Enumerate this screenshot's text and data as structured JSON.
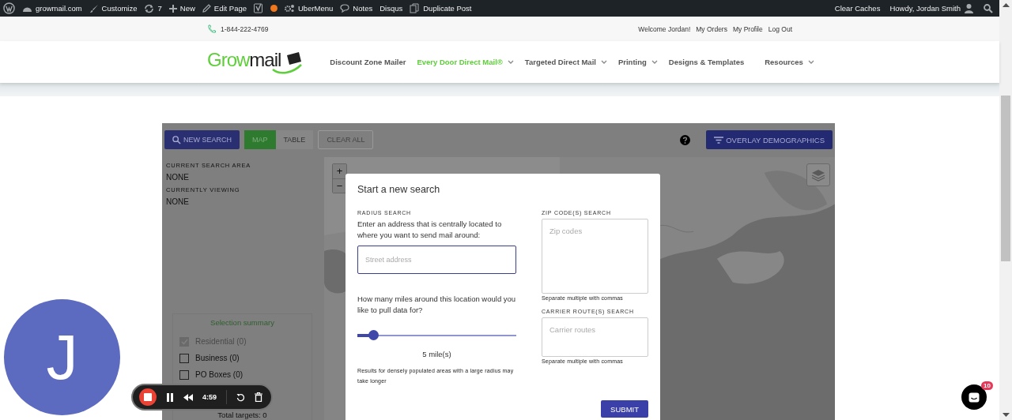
{
  "admin_bar": {
    "items": [
      {
        "kind": "wordpress"
      },
      {
        "kind": "site",
        "label": "growmail.com"
      },
      {
        "kind": "customize",
        "label": "Customize"
      },
      {
        "kind": "updates",
        "label": "7"
      },
      {
        "kind": "new",
        "label": "New"
      },
      {
        "kind": "edit",
        "label": "Edit Page"
      },
      {
        "kind": "seo"
      },
      {
        "kind": "status"
      },
      {
        "kind": "gears",
        "label": "UberMenu"
      },
      {
        "kind": "notes",
        "label": "Notes"
      },
      {
        "kind": "plain",
        "label": "Disqus"
      },
      {
        "kind": "duplicate",
        "label": "Duplicate Post"
      }
    ],
    "right": {
      "clear": "Clear Caches",
      "howdy": "Howdy, Jordan Smith"
    }
  },
  "top_bar": {
    "phone": "1-844-222-4769",
    "links": [
      "Welcome Jordan!",
      "My Orders",
      "My Profile",
      "Log Out"
    ]
  },
  "nav": {
    "logo": {
      "text_1": "Grow",
      "text_2": "mail"
    },
    "items": [
      {
        "label": "Discount Zone Mailer",
        "dropdown": false,
        "selected": false
      },
      {
        "label": "Every Door Direct Mail®",
        "dropdown": true,
        "selected": true
      },
      {
        "label": "Targeted Direct Mail",
        "dropdown": true,
        "selected": false
      },
      {
        "label": "Printing",
        "dropdown": true,
        "selected": false
      },
      {
        "label": "Designs & Templates",
        "dropdown": false,
        "selected": false
      },
      {
        "label": "Resources",
        "dropdown": true,
        "selected": false
      }
    ]
  },
  "toolbar": {
    "new_search": "NEW SEARCH",
    "views": [
      {
        "label": "MAP",
        "selected": true
      },
      {
        "label": "TABLE",
        "selected": false
      }
    ],
    "clear": "CLEAR ALL",
    "overlay": "OVERLAY DEMOGRAPHICS"
  },
  "sidebar": {
    "sections": [
      {
        "heading": "CURRENT SEARCH AREA",
        "value": "NONE"
      },
      {
        "heading": "CURRENTLY VIEWING",
        "value": "NONE"
      }
    ],
    "summary": {
      "title": "Selection summary",
      "items": [
        {
          "label": "Residential (0)",
          "checked": true,
          "disabled": true
        },
        {
          "label": "Business (0)",
          "checked": false,
          "disabled": false
        },
        {
          "label": "PO Boxes (0)",
          "checked": false,
          "disabled": false
        }
      ],
      "total": "Total targets: 0"
    }
  },
  "map": {
    "zoom_in": "+",
    "zoom_out": "−"
  },
  "modal": {
    "title": "Start a new search",
    "radius": {
      "heading": "RADIUS SEARCH",
      "prompt": "Enter an address that is centrally located to where you want to send mail around:",
      "placeholder": "Street address",
      "question": "How many miles around this location would you like to pull data for?",
      "level": 0.1,
      "reading": "5 mile(s)",
      "note": "Results for densely populated areas with a large radius may take longer"
    },
    "zip": {
      "heading": "ZIP CODE(S) SEARCH",
      "placeholder": "Zip codes",
      "hint": "Separate multiple with commas"
    },
    "carrier": {
      "heading": "CARRIER ROUTE(S) SEARCH",
      "placeholder": "Carrier routes",
      "hint": "Separate multiple with commas"
    },
    "submit": "SUBMIT"
  },
  "avatar": {
    "letter": "J"
  },
  "recorder": {
    "time": "4:59"
  },
  "chat": {
    "badge": "10"
  }
}
